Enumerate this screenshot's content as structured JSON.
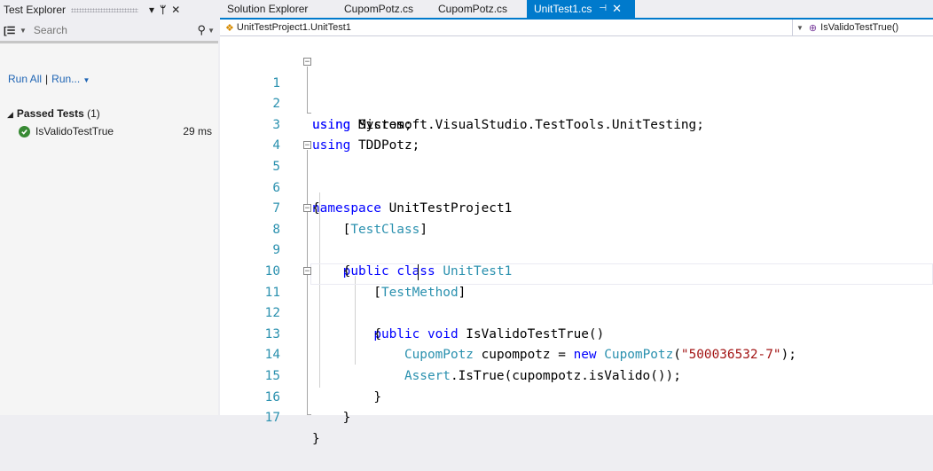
{
  "test_explorer": {
    "title": "Test Explorer",
    "pin": "Ͱ",
    "close": "✕",
    "search_placeholder": "Search",
    "run_all": "Run All",
    "run_menu": "Run...",
    "passed_label": "Passed Tests",
    "passed_count": "(1)",
    "test_name": "IsValidoTestTrue",
    "test_duration": "29 ms"
  },
  "tabs": {
    "solution_explorer": "Solution Explorer",
    "cupom1": "CupomPotz.cs",
    "cupom2": "CupomPotz.cs",
    "active": "UnitTest1.cs"
  },
  "navbar": {
    "class_path": "UnitTestProject1.UnitTest1",
    "member": "IsValidoTestTrue()"
  },
  "code": {
    "line_numbers": [
      "1",
      "2",
      "3",
      "4",
      "5",
      "6",
      "7",
      "8",
      "9",
      "10",
      "11",
      "12",
      "13",
      "14",
      "15",
      "16",
      "17"
    ],
    "kw_using": "using",
    "ns_system": " System;",
    "ns_mstest": " Microsoft.VisualStudio.TestTools.UnitTesting;",
    "ns_tdd": " TDDPotz;",
    "kw_namespace": "namespace",
    "ns_name": " UnitTestProject1",
    "brace_open": "{",
    "brace_close": "}",
    "attr_testclass": "TestClass",
    "kw_public": "public",
    "kw_class": "class",
    "class_name": "UnitTest1",
    "attr_testmethod": "TestMethod",
    "kw_void": "void",
    "method_decl": " IsValidoTestTrue()",
    "type_cupom": "CupomPotz",
    "var_decl": " cupompotz = ",
    "kw_new": "new",
    "ctor_arg": "\"500036532-7\"",
    "assert_type": "Assert",
    "assert_call": ".IsTrue(cupompotz.isValido());"
  },
  "colors": {
    "accent": "#007acc",
    "keyword": "#0000ff",
    "type": "#2b91af",
    "string": "#a31515",
    "passed": "#388a34"
  }
}
